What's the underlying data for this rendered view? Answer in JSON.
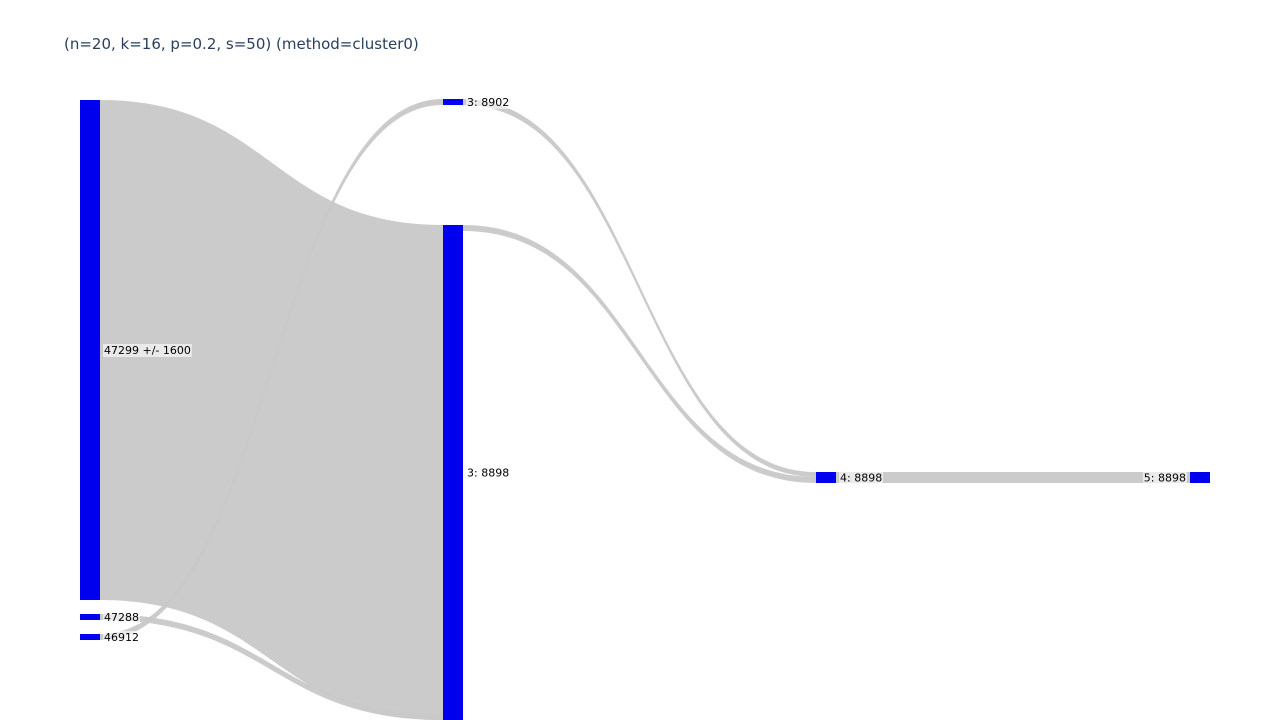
{
  "title": "(n=20, k=16, p=0.2, s=50) (method=cluster0)",
  "colors": {
    "node": "#0000ee",
    "link": "#c8c8c8",
    "title": "#2a3f5f"
  },
  "nodes": [
    {
      "id": "n0",
      "label": "47299 +/- 1600"
    },
    {
      "id": "n1",
      "label": "47288"
    },
    {
      "id": "n2",
      "label": "46912"
    },
    {
      "id": "n3",
      "label": "3: 8902"
    },
    {
      "id": "n4",
      "label": "3: 8898"
    },
    {
      "id": "n5",
      "label": "4: 8898"
    },
    {
      "id": "n6",
      "label": "5: 8898"
    }
  ],
  "links": [
    {
      "source": "n0",
      "target": "n4"
    },
    {
      "source": "n1",
      "target": "n4"
    },
    {
      "source": "n2",
      "target": "n3"
    },
    {
      "source": "n3",
      "target": "n5"
    },
    {
      "source": "n4",
      "target": "n5"
    },
    {
      "source": "n5",
      "target": "n6"
    }
  ]
}
